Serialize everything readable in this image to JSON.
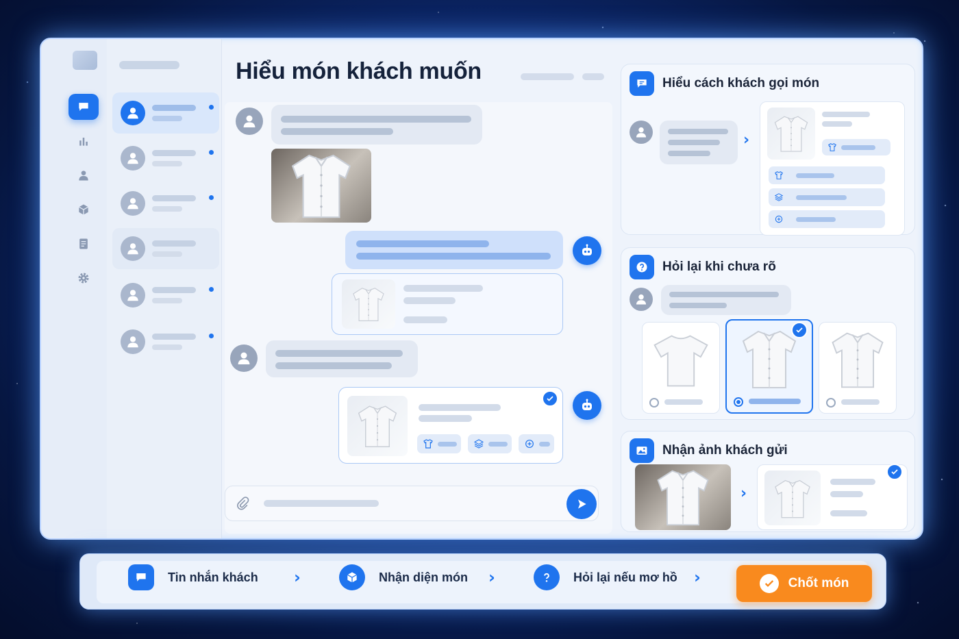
{
  "window": {
    "title": "Hiểu món khách muốn"
  },
  "sidebar": {
    "items": [
      {
        "icon": "chat-icon",
        "active": true
      },
      {
        "icon": "bar-chart-icon",
        "active": false
      },
      {
        "icon": "user-icon",
        "active": false
      },
      {
        "icon": "box-icon",
        "active": false
      },
      {
        "icon": "document-icon",
        "active": false
      },
      {
        "icon": "gear-icon",
        "active": false
      }
    ]
  },
  "conversations": {
    "items": [
      {
        "active": true,
        "unread": true
      },
      {
        "active": false,
        "unread": true
      },
      {
        "active": false,
        "unread": true
      },
      {
        "active": false,
        "unread": false
      },
      {
        "active": false,
        "unread": true
      },
      {
        "active": false,
        "unread": true
      }
    ]
  },
  "panels": {
    "understand": {
      "title": "Hiểu cách khách gọi món",
      "icon": "chat-icon"
    },
    "clarify": {
      "title": "Hỏi lại khi chưa rõ",
      "icon": "question-icon",
      "selected_option": 2
    },
    "image": {
      "title": "Nhận ảnh khách gửi",
      "icon": "image-icon"
    }
  },
  "flow": {
    "steps": [
      {
        "label": "Tin nhắn khách",
        "icon": "chat-icon"
      },
      {
        "label": "Nhận diện món",
        "icon": "box-icon"
      },
      {
        "label": "Hỏi lại nếu mơ hồ",
        "icon": "question-icon"
      }
    ],
    "cta": {
      "label": "Chốt món",
      "icon": "check-icon"
    }
  },
  "colors": {
    "accent": "#1f74ee",
    "cta": "#f98a1e",
    "background": "#0d2a72"
  }
}
